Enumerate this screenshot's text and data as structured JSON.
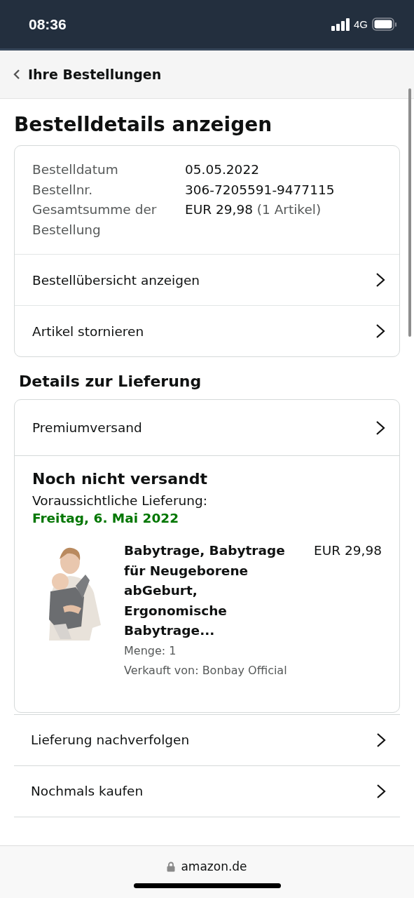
{
  "status_bar": {
    "time": "08:36",
    "network": "4G"
  },
  "nav": {
    "back_label": "Ihre Bestellungen"
  },
  "title": "Bestelldetails anzeigen",
  "order_info": {
    "fields": [
      {
        "label": "Bestelldatum",
        "value": "05.05.2022"
      },
      {
        "label": "Bestellnr.",
        "value": "306-7205591-9477115"
      },
      {
        "label": "Gesamtsumme der Bestellung",
        "value": "EUR 29,98",
        "note": "(1 Artikel)"
      }
    ],
    "links": [
      "Bestellübersicht anzeigen",
      "Artikel stornieren"
    ]
  },
  "delivery": {
    "heading": "Details zur Lieferung",
    "shipping_method": "Premiumversand",
    "status": "Noch nicht versandt",
    "eta_label": "Voraussichtliche Lieferung:",
    "eta_date": "Freitag, 6. Mai 2022",
    "items": [
      {
        "title": "Babytrage, Babytrage für Neugeborene abGeburt, Ergonomische Babytrage...",
        "price": "EUR 29,98",
        "quantity": "Menge: 1",
        "seller": "Verkauft von: Bonbay Official"
      }
    ]
  },
  "actions": [
    "Lieferung nachverfolgen",
    "Nochmals kaufen"
  ],
  "browser_bar": {
    "url": "amazon.de"
  }
}
